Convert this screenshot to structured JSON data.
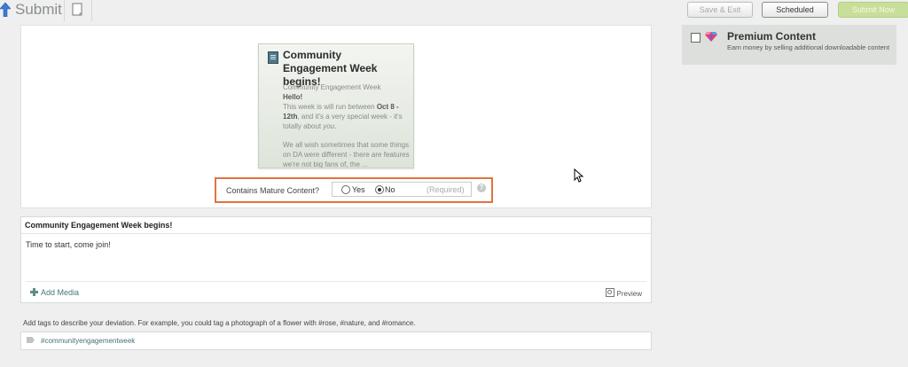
{
  "header": {
    "title": "Submit",
    "up_icon": "up-arrow-icon",
    "doc_icon": "document-icon"
  },
  "actions": {
    "save_exit": "Save & Exit",
    "scheduled": "Scheduled",
    "submit_now": "Submit Now"
  },
  "preview": {
    "title": "Community Engagement Week begins!",
    "body_line1": "Community Engagement Week",
    "body_line2": "Hello!",
    "body_p1_a": "This week is will run between ",
    "body_p1_b": "Oct 8 - 12th",
    "body_p1_c": ", and it's  a very special week - it's totally about ",
    "body_p1_d": "you",
    "body_p1_e": ".",
    "body_p2": "We all wish sometimes that some things on DA were different - there are features we're not big fans of, the ..."
  },
  "mature": {
    "label": "Contains Mature Content?",
    "yes": "Yes",
    "no": "No",
    "required": "(Required)",
    "selected": "No",
    "help": "?"
  },
  "editor": {
    "title": "Community Engagement Week begins!",
    "body": "Time to start, come join!",
    "add_media": "Add Media",
    "preview": "Preview"
  },
  "tags": {
    "hint": "Add tags to describe your deviation. For example, you could tag a photograph of a flower with #rose, #nature, and #romance.",
    "value": "#communityengagementweek"
  },
  "premium": {
    "title": "Premium Content",
    "description": "Earn money by selling additional downloadable content",
    "checked": false
  },
  "colors": {
    "accent_highlight": "#e0743f",
    "submit_button": "#c7df99",
    "link": "#47767a"
  }
}
